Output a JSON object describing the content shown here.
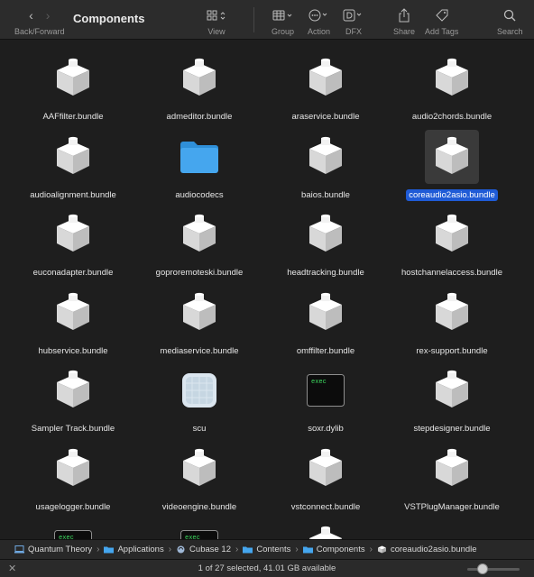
{
  "toolbar": {
    "title": "Components",
    "back_forward_label": "Back/Forward",
    "view_label": "View",
    "group_label": "Group",
    "action_label": "Action",
    "dfx_label": "DFX",
    "share_label": "Share",
    "add_tags_label": "Add Tags",
    "search_label": "Search"
  },
  "items": [
    {
      "name": "AAFfilter.bundle",
      "icon": "bundle-icon"
    },
    {
      "name": "admeditor.bundle",
      "icon": "bundle-icon"
    },
    {
      "name": "araservice.bundle",
      "icon": "bundle-icon"
    },
    {
      "name": "audio2chords.bundle",
      "icon": "bundle-icon"
    },
    {
      "name": "audioalignment.bundle",
      "icon": "bundle-icon"
    },
    {
      "name": "audiocodecs",
      "icon": "folder-icon"
    },
    {
      "name": "baios.bundle",
      "icon": "bundle-icon"
    },
    {
      "name": "coreaudio2asio.bundle",
      "icon": "bundle-icon",
      "selected": true
    },
    {
      "name": "euconadapter.bundle",
      "icon": "bundle-icon"
    },
    {
      "name": "goproremoteski.bundle",
      "icon": "bundle-icon"
    },
    {
      "name": "headtracking.bundle",
      "icon": "bundle-icon"
    },
    {
      "name": "hostchannelaccess.bundle",
      "icon": "bundle-icon"
    },
    {
      "name": "hubservice.bundle",
      "icon": "bundle-icon"
    },
    {
      "name": "mediaservice.bundle",
      "icon": "bundle-icon"
    },
    {
      "name": "omffilter.bundle",
      "icon": "bundle-icon"
    },
    {
      "name": "rex-support.bundle",
      "icon": "bundle-icon"
    },
    {
      "name": "Sampler Track.bundle",
      "icon": "bundle-icon"
    },
    {
      "name": "scu",
      "icon": "document-icon"
    },
    {
      "name": "soxr.dylib",
      "icon": "exec-icon"
    },
    {
      "name": "stepdesigner.bundle",
      "icon": "bundle-icon"
    },
    {
      "name": "usagelogger.bundle",
      "icon": "bundle-icon"
    },
    {
      "name": "videoengine.bundle",
      "icon": "bundle-icon"
    },
    {
      "name": "vstconnect.bundle",
      "icon": "bundle-icon"
    },
    {
      "name": "VSTPlugManager.bundle",
      "icon": "bundle-icon"
    },
    {
      "name": "",
      "icon": "exec-icon"
    },
    {
      "name": "",
      "icon": "exec-icon"
    },
    {
      "name": "",
      "icon": "bundle-icon"
    }
  ],
  "exec_text": "exec",
  "pathbar": [
    {
      "label": "Quantum Theory",
      "icon": "computer-icon"
    },
    {
      "label": "Applications",
      "icon": "folder-icon"
    },
    {
      "label": "Cubase 12",
      "icon": "cubase-icon"
    },
    {
      "label": "Contents",
      "icon": "folder-icon"
    },
    {
      "label": "Components",
      "icon": "folder-icon"
    },
    {
      "label": "coreaudio2asio.bundle",
      "icon": "bundle-icon"
    }
  ],
  "status": {
    "text": "1 of 27 selected, 41.01 GB available",
    "icon_size_level": 0.3
  }
}
